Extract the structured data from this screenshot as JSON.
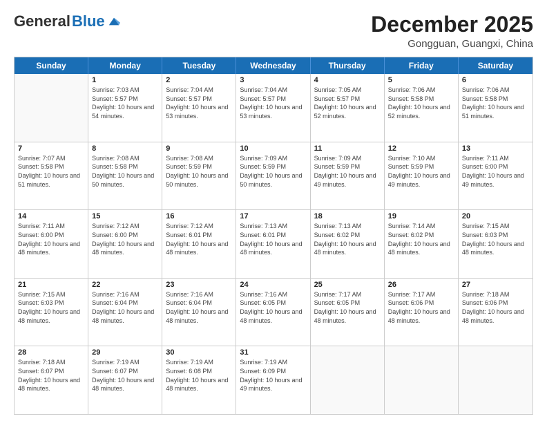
{
  "logo": {
    "general": "General",
    "blue": "Blue"
  },
  "header": {
    "month": "December 2025",
    "location": "Gongguan, Guangxi, China"
  },
  "weekdays": [
    "Sunday",
    "Monday",
    "Tuesday",
    "Wednesday",
    "Thursday",
    "Friday",
    "Saturday"
  ],
  "weeks": [
    [
      {
        "day": "",
        "empty": true
      },
      {
        "day": "1",
        "sunrise": "7:03 AM",
        "sunset": "5:57 PM",
        "daylight": "10 hours and 54 minutes."
      },
      {
        "day": "2",
        "sunrise": "7:04 AM",
        "sunset": "5:57 PM",
        "daylight": "10 hours and 53 minutes."
      },
      {
        "day": "3",
        "sunrise": "7:04 AM",
        "sunset": "5:57 PM",
        "daylight": "10 hours and 53 minutes."
      },
      {
        "day": "4",
        "sunrise": "7:05 AM",
        "sunset": "5:57 PM",
        "daylight": "10 hours and 52 minutes."
      },
      {
        "day": "5",
        "sunrise": "7:06 AM",
        "sunset": "5:58 PM",
        "daylight": "10 hours and 52 minutes."
      },
      {
        "day": "6",
        "sunrise": "7:06 AM",
        "sunset": "5:58 PM",
        "daylight": "10 hours and 51 minutes."
      }
    ],
    [
      {
        "day": "7",
        "sunrise": "7:07 AM",
        "sunset": "5:58 PM",
        "daylight": "10 hours and 51 minutes."
      },
      {
        "day": "8",
        "sunrise": "7:08 AM",
        "sunset": "5:58 PM",
        "daylight": "10 hours and 50 minutes."
      },
      {
        "day": "9",
        "sunrise": "7:08 AM",
        "sunset": "5:59 PM",
        "daylight": "10 hours and 50 minutes."
      },
      {
        "day": "10",
        "sunrise": "7:09 AM",
        "sunset": "5:59 PM",
        "daylight": "10 hours and 50 minutes."
      },
      {
        "day": "11",
        "sunrise": "7:09 AM",
        "sunset": "5:59 PM",
        "daylight": "10 hours and 49 minutes."
      },
      {
        "day": "12",
        "sunrise": "7:10 AM",
        "sunset": "5:59 PM",
        "daylight": "10 hours and 49 minutes."
      },
      {
        "day": "13",
        "sunrise": "7:11 AM",
        "sunset": "6:00 PM",
        "daylight": "10 hours and 49 minutes."
      }
    ],
    [
      {
        "day": "14",
        "sunrise": "7:11 AM",
        "sunset": "6:00 PM",
        "daylight": "10 hours and 48 minutes."
      },
      {
        "day": "15",
        "sunrise": "7:12 AM",
        "sunset": "6:00 PM",
        "daylight": "10 hours and 48 minutes."
      },
      {
        "day": "16",
        "sunrise": "7:12 AM",
        "sunset": "6:01 PM",
        "daylight": "10 hours and 48 minutes."
      },
      {
        "day": "17",
        "sunrise": "7:13 AM",
        "sunset": "6:01 PM",
        "daylight": "10 hours and 48 minutes."
      },
      {
        "day": "18",
        "sunrise": "7:13 AM",
        "sunset": "6:02 PM",
        "daylight": "10 hours and 48 minutes."
      },
      {
        "day": "19",
        "sunrise": "7:14 AM",
        "sunset": "6:02 PM",
        "daylight": "10 hours and 48 minutes."
      },
      {
        "day": "20",
        "sunrise": "7:15 AM",
        "sunset": "6:03 PM",
        "daylight": "10 hours and 48 minutes."
      }
    ],
    [
      {
        "day": "21",
        "sunrise": "7:15 AM",
        "sunset": "6:03 PM",
        "daylight": "10 hours and 48 minutes."
      },
      {
        "day": "22",
        "sunrise": "7:16 AM",
        "sunset": "6:04 PM",
        "daylight": "10 hours and 48 minutes."
      },
      {
        "day": "23",
        "sunrise": "7:16 AM",
        "sunset": "6:04 PM",
        "daylight": "10 hours and 48 minutes."
      },
      {
        "day": "24",
        "sunrise": "7:16 AM",
        "sunset": "6:05 PM",
        "daylight": "10 hours and 48 minutes."
      },
      {
        "day": "25",
        "sunrise": "7:17 AM",
        "sunset": "6:05 PM",
        "daylight": "10 hours and 48 minutes."
      },
      {
        "day": "26",
        "sunrise": "7:17 AM",
        "sunset": "6:06 PM",
        "daylight": "10 hours and 48 minutes."
      },
      {
        "day": "27",
        "sunrise": "7:18 AM",
        "sunset": "6:06 PM",
        "daylight": "10 hours and 48 minutes."
      }
    ],
    [
      {
        "day": "28",
        "sunrise": "7:18 AM",
        "sunset": "6:07 PM",
        "daylight": "10 hours and 48 minutes."
      },
      {
        "day": "29",
        "sunrise": "7:19 AM",
        "sunset": "6:07 PM",
        "daylight": "10 hours and 48 minutes."
      },
      {
        "day": "30",
        "sunrise": "7:19 AM",
        "sunset": "6:08 PM",
        "daylight": "10 hours and 48 minutes."
      },
      {
        "day": "31",
        "sunrise": "7:19 AM",
        "sunset": "6:09 PM",
        "daylight": "10 hours and 49 minutes."
      },
      {
        "day": "",
        "empty": true
      },
      {
        "day": "",
        "empty": true
      },
      {
        "day": "",
        "empty": true
      }
    ]
  ]
}
